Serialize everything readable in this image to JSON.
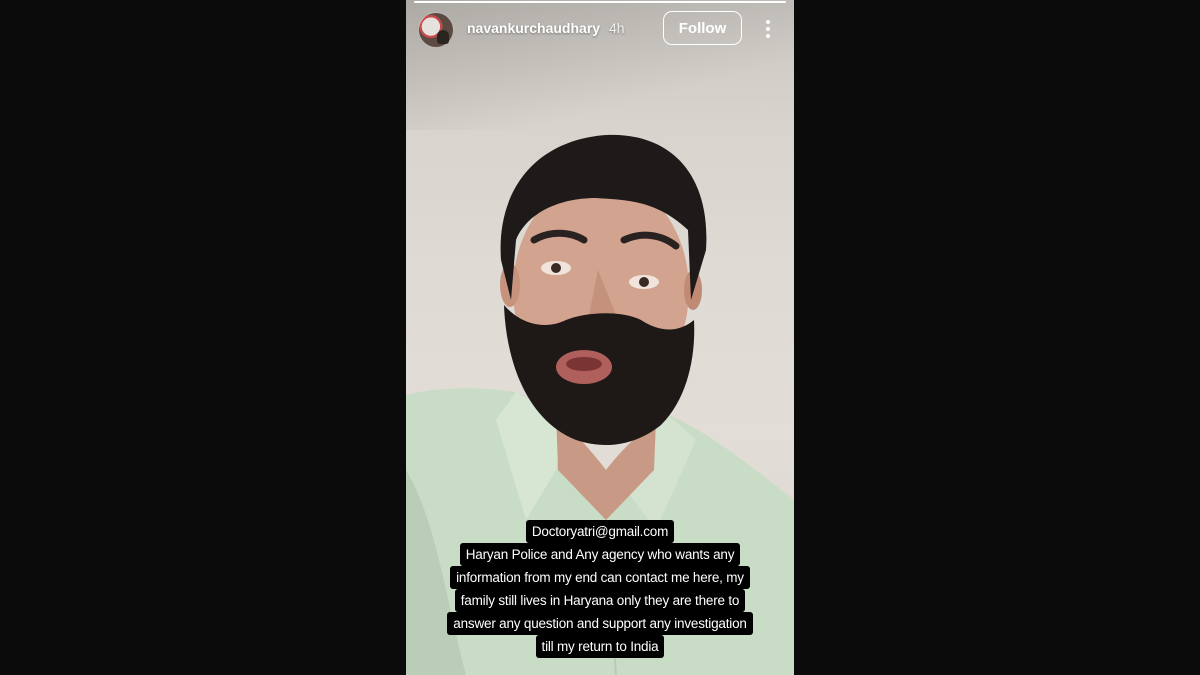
{
  "story": {
    "username": "navankurchaudhary",
    "time_ago": "4h",
    "follow_label": "Follow",
    "progress_fraction": 1.0,
    "caption_lines": [
      "Doctoryatri@gmail.com",
      "Haryan Police and Any agency who wants any",
      "information from my end can contact me here, my",
      "family still lives in Haryana only they are there to",
      "answer any question and support any investigation",
      "till my return to India"
    ]
  },
  "icons": {
    "more": "more-vertical-icon"
  },
  "colors": {
    "background": "#0b0b0b",
    "caption_bg": "#000000",
    "text": "#ffffff"
  }
}
